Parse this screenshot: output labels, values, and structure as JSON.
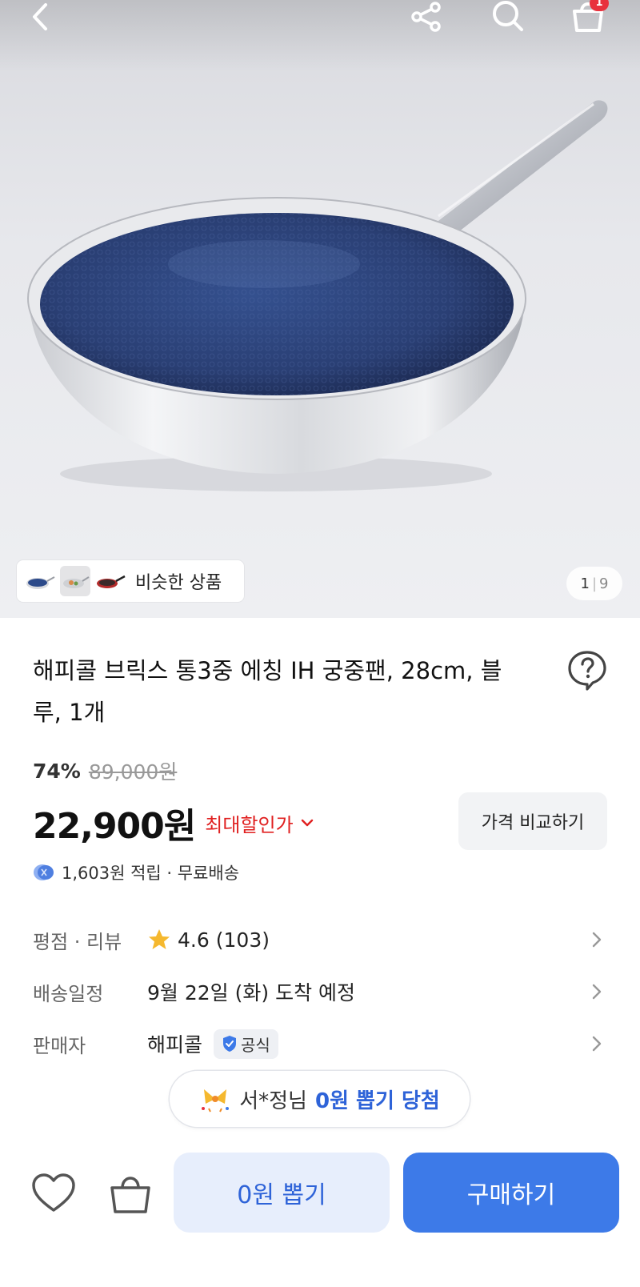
{
  "header": {
    "back_icon": "chevron-left-icon",
    "share_icon": "share-icon",
    "search_icon": "search-icon",
    "cart_icon": "cart-icon",
    "cart_count": "1"
  },
  "gallery": {
    "similar_label": "비슷한 상품",
    "current_page": "1",
    "page_separator": "|",
    "total_pages": "9"
  },
  "product": {
    "title": "해피콜 브릭스 통3중 에칭 IH 궁중팬, 28cm, 블루, 1개",
    "discount_percent": "74%",
    "original_price": "89,000원",
    "price": "22,900원",
    "max_discount_label": "최대할인가",
    "compare_label": "가격 비교하기",
    "reward_text": "1,603원 적립 · 무료배송"
  },
  "details": {
    "rating_label": "평점 · 리뷰",
    "rating_value": "4.6",
    "review_count": "(103)",
    "shipping_label": "배송일정",
    "shipping_value": "9월 22일 (화) 도착 예정",
    "seller_label": "판매자",
    "seller_value": "해피콜",
    "official_badge": "공식"
  },
  "banner": {
    "winner": "서*정님",
    "prize": "0원 뽑기 당첨"
  },
  "bottom_bar": {
    "pick_label": "0원 뽑기",
    "buy_label": "구매하기"
  },
  "colors": {
    "accent_blue": "#3d7ae8",
    "discount_red": "#e02020",
    "badge_red": "#e8313d"
  }
}
